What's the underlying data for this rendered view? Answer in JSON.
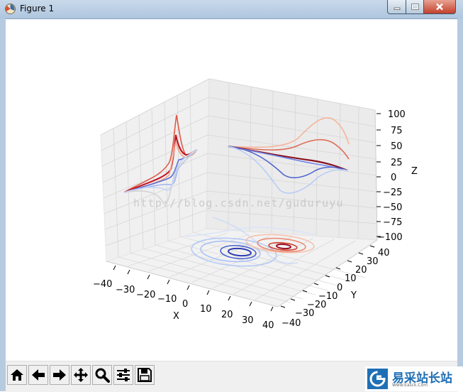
{
  "window": {
    "title": "Figure 1"
  },
  "colors": {
    "titlebar": "#aec6df",
    "close": "#c2402b",
    "pane": "#f2f2f2",
    "grid": "#d7d7d7"
  },
  "axes": {
    "x_label": "X",
    "y_label": "Y",
    "z_label": "Z",
    "x_ticks": [
      "−40",
      "−30",
      "−20",
      "−10",
      "0",
      "10",
      "20",
      "30",
      "40"
    ],
    "y_ticks": [
      "−40",
      "−30",
      "−20",
      "−10",
      "0",
      "10",
      "20",
      "30",
      "40"
    ],
    "z_ticks": [
      "100",
      "75",
      "50",
      "25",
      "0",
      "−25",
      "−50",
      "−75",
      "−100"
    ]
  },
  "watermark_url": "http://blog.csdn.net/guduruyu",
  "toolbar": {
    "buttons": [
      "home-icon",
      "back-icon",
      "forward-icon",
      "pan-icon",
      "zoom-icon",
      "subplots-icon",
      "save-icon"
    ]
  },
  "site_logo": {
    "name_cn": "易采站长站",
    "name_en": "Www.Easck.Com"
  }
}
